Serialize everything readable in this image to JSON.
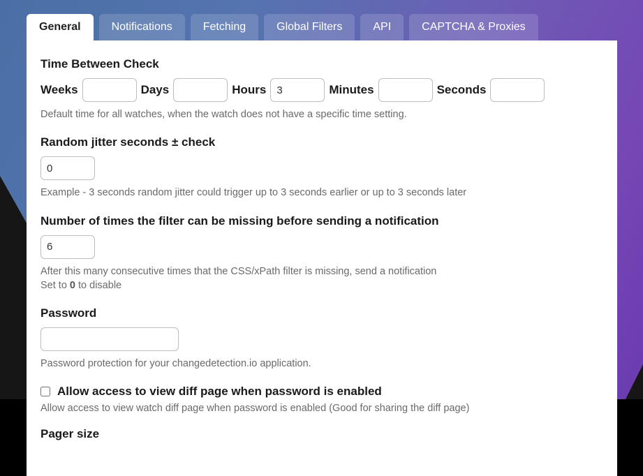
{
  "tabs": [
    {
      "label": "General",
      "active": true
    },
    {
      "label": "Notifications",
      "active": false
    },
    {
      "label": "Fetching",
      "active": false
    },
    {
      "label": "Global Filters",
      "active": false
    },
    {
      "label": "API",
      "active": false
    },
    {
      "label": "CAPTCHA & Proxies",
      "active": false
    }
  ],
  "time_between": {
    "heading": "Time Between Check",
    "weeks_label": "Weeks",
    "days_label": "Days",
    "hours_label": "Hours",
    "minutes_label": "Minutes",
    "seconds_label": "Seconds",
    "weeks": "",
    "days": "",
    "hours": "3",
    "minutes": "",
    "seconds": "",
    "helper": "Default time for all watches, when the watch does not have a specific time setting."
  },
  "jitter": {
    "heading": "Random jitter seconds ± check",
    "value": "0",
    "helper": "Example - 3 seconds random jitter could trigger up to 3 seconds earlier or up to 3 seconds later"
  },
  "filter_missing": {
    "heading": "Number of times the filter can be missing before sending a notification",
    "value": "6",
    "helper_line1": "After this many consecutive times that the CSS/xPath filter is missing, send a notification",
    "helper_prefix": "Set to ",
    "helper_bold": "0",
    "helper_suffix": " to disable"
  },
  "password": {
    "heading": "Password",
    "value": "",
    "helper": "Password protection for your changedetection.io application."
  },
  "allow_diff": {
    "label": "Allow access to view diff page when password is enabled",
    "checked": false,
    "helper": "Allow access to view watch diff page when password is enabled (Good for sharing the diff page)"
  },
  "pager": {
    "heading": "Pager size"
  }
}
